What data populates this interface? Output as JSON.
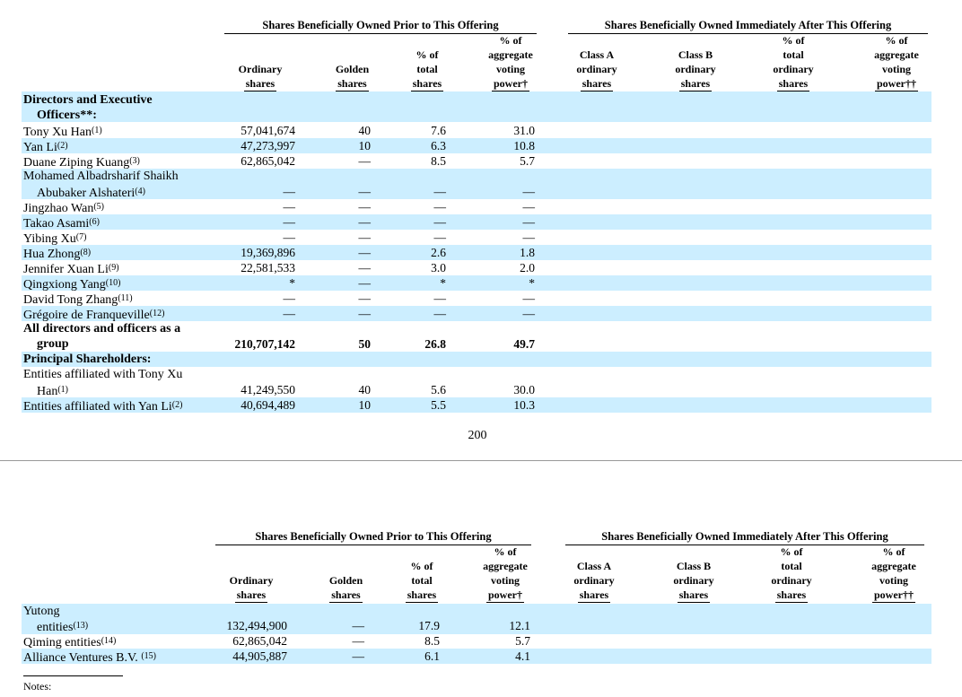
{
  "page_number": "200",
  "notes_label": "Notes:",
  "headers": {
    "prior": "Shares Beneficially Owned Prior to This Offering",
    "after": "Shares Beneficially Owned Immediately After This Offering",
    "prior_cols": {
      "ordinary_l1": "Ordinary",
      "ordinary_l2": "shares",
      "golden_l1": "Golden",
      "golden_l2": "shares",
      "pct_l1": "% of",
      "pct_l2": "total",
      "pct_l3": "shares",
      "vote_l1": "% of",
      "vote_l2": "aggregate",
      "vote_l3": "voting",
      "vote_l4": "power†"
    },
    "after_cols": {
      "a_l1": "Class A",
      "a_l2": "ordinary",
      "a_l3": "shares",
      "b_l1": "Class B",
      "b_l2": "ordinary",
      "b_l3": "shares",
      "pct_l1": "% of",
      "pct_l2": "total",
      "pct_l3": "ordinary",
      "pct_l4": "shares",
      "vote_l1": "% of",
      "vote_l2": "aggregate",
      "vote_l3": "voting",
      "vote_l4": "power††"
    }
  },
  "table1": {
    "section_directors_l1": "Directors and Executive",
    "section_directors_l2": "Officers**:",
    "rows": [
      {
        "name": "Tony Xu Han",
        "fn": "(1)",
        "ord": "57,041,674",
        "golden": "40",
        "pct": "7.6",
        "vote": "31.0"
      },
      {
        "name": "Yan Li",
        "fn": "(2)",
        "ord": "47,273,997",
        "golden": "10",
        "pct": "6.3",
        "vote": "10.8"
      },
      {
        "name": "Duane Ziping Kuang",
        "fn": "(3)",
        "ord": "62,865,042",
        "golden": "—",
        "pct": "8.5",
        "vote": "5.7"
      },
      {
        "name_l1": "Mohamed Albadrsharif Shaikh",
        "name_l2": "Abubaker Alshateri",
        "fn": "(4)",
        "ord": "—",
        "golden": "—",
        "pct": "—",
        "vote": "—"
      },
      {
        "name": "Jingzhao Wan",
        "fn": "(5)",
        "ord": "—",
        "golden": "—",
        "pct": "—",
        "vote": "—"
      },
      {
        "name": "Takao Asami",
        "fn": "(6)",
        "ord": "—",
        "golden": "—",
        "pct": "—",
        "vote": "—"
      },
      {
        "name": "Yibing Xu",
        "fn": "(7)",
        "ord": "—",
        "golden": "—",
        "pct": "—",
        "vote": "—"
      },
      {
        "name": "Hua Zhong",
        "fn": "(8)",
        "ord": "19,369,896",
        "golden": "—",
        "pct": "2.6",
        "vote": "1.8"
      },
      {
        "name": "Jennifer Xuan Li",
        "fn": "(9)",
        "ord": "22,581,533",
        "golden": "—",
        "pct": "3.0",
        "vote": "2.0"
      },
      {
        "name": "Qingxiong Yang",
        "fn": "(10)",
        "ord": "*",
        "golden": "—",
        "pct": "*",
        "vote": "*"
      },
      {
        "name": "David Tong Zhang",
        "fn": "(11)",
        "ord": "—",
        "golden": "—",
        "pct": "—",
        "vote": "—"
      },
      {
        "name": "Grégoire de Franqueville",
        "fn": "(12)",
        "ord": "—",
        "golden": "—",
        "pct": "—",
        "vote": "—"
      }
    ],
    "all_directors": {
      "name_l1": "All directors and officers as a",
      "name_l2": "group",
      "ord": "210,707,142",
      "golden": "50",
      "pct": "26.8",
      "vote": "49.7"
    },
    "section_principal": "Principal Shareholders:",
    "principal_rows": [
      {
        "name_l1": "Entities affiliated with Tony Xu",
        "name_l2": "Han",
        "fn": "(1)",
        "ord": "41,249,550",
        "golden": "40",
        "pct": "5.6",
        "vote": "30.0"
      },
      {
        "name": "Entities affiliated with Yan Li",
        "fn": "(2)",
        "ord": "40,694,489",
        "golden": "10",
        "pct": "5.5",
        "vote": "10.3"
      }
    ]
  },
  "table2": {
    "rows": [
      {
        "name_l1": "Yutong",
        "name_l2": "entities",
        "fn": "(13)",
        "ord": "132,494,900",
        "golden": "—",
        "pct": "17.9",
        "vote": "12.1"
      },
      {
        "name": "Qiming entities",
        "fn": "(14)",
        "ord": "62,865,042",
        "golden": "—",
        "pct": "8.5",
        "vote": "5.7"
      },
      {
        "name": "Alliance Ventures B.V. ",
        "fn": "(15)",
        "ord": "44,905,887",
        "golden": "—",
        "pct": "6.1",
        "vote": "4.1"
      }
    ]
  }
}
